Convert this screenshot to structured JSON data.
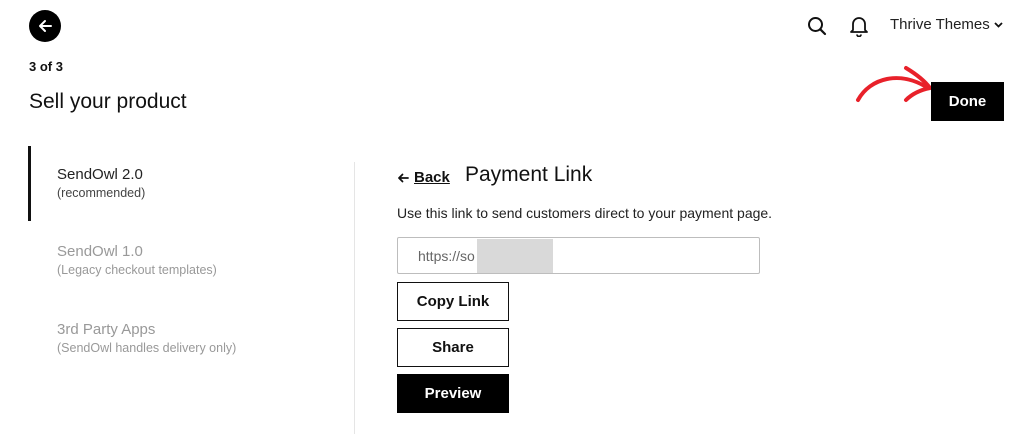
{
  "header": {
    "account_name": "Thrive Themes",
    "step_indicator": "3 of 3",
    "page_title": "Sell your product",
    "done_label": "Done"
  },
  "sidebar": {
    "items": [
      {
        "title": "SendOwl 2.0",
        "subtitle": "(recommended)",
        "active": true
      },
      {
        "title": "SendOwl 1.0",
        "subtitle": "(Legacy checkout templates)",
        "active": false
      },
      {
        "title": "3rd Party Apps",
        "subtitle": "(SendOwl handles delivery only)",
        "active": false
      }
    ]
  },
  "main": {
    "back_label": "Back",
    "section_title": "Payment Link",
    "description": "Use this link to send customers direct to your payment page.",
    "link_value": "https://so",
    "buttons": {
      "copy_link": "Copy Link",
      "share": "Share",
      "preview": "Preview"
    }
  },
  "colors": {
    "primary": "#000000",
    "annotation": "#e8212a",
    "muted_text": "#999999"
  },
  "icons": [
    "back-arrow-icon",
    "search-icon",
    "bell-icon",
    "chevron-down-icon",
    "left-arrow-icon"
  ]
}
